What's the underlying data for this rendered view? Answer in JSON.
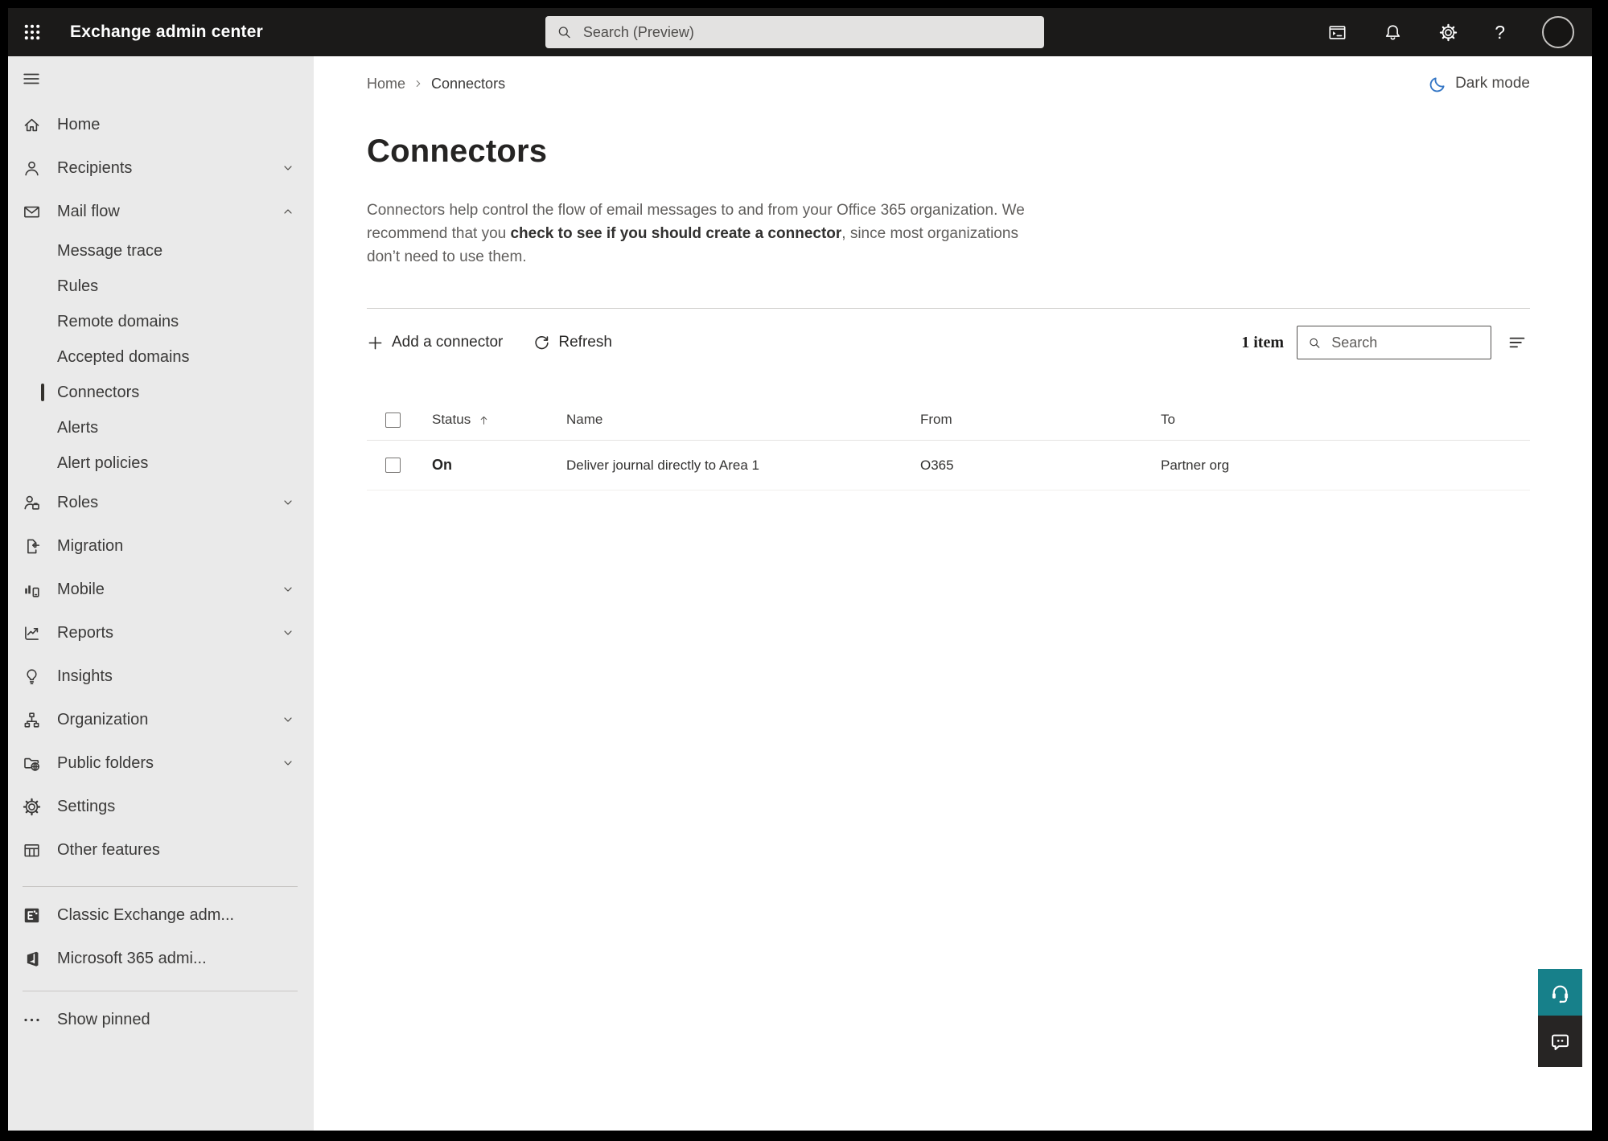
{
  "topbar": {
    "title": "Exchange admin center",
    "search_placeholder": "Search (Preview)"
  },
  "sidebar": {
    "items": [
      {
        "label": "Home"
      },
      {
        "label": "Recipients"
      },
      {
        "label": "Mail flow"
      },
      {
        "label": "Message trace"
      },
      {
        "label": "Rules"
      },
      {
        "label": "Remote domains"
      },
      {
        "label": "Accepted domains"
      },
      {
        "label": "Connectors",
        "selected": true
      },
      {
        "label": "Alerts"
      },
      {
        "label": "Alert policies"
      },
      {
        "label": "Roles"
      },
      {
        "label": "Migration"
      },
      {
        "label": "Mobile"
      },
      {
        "label": "Reports"
      },
      {
        "label": "Insights"
      },
      {
        "label": "Organization"
      },
      {
        "label": "Public folders"
      },
      {
        "label": "Settings"
      },
      {
        "label": "Other features"
      },
      {
        "label": "Classic Exchange adm..."
      },
      {
        "label": "Microsoft 365 admi..."
      },
      {
        "label": "Show pinned"
      }
    ]
  },
  "main": {
    "breadcrumb": {
      "home": "Home",
      "current": "Connectors"
    },
    "dark_mode_label": "Dark mode",
    "page_title": "Connectors",
    "description": {
      "pre": "Connectors help control the flow of email messages to and from your Office 365 organization. We recommend that you ",
      "link": "check to see if you should create a connector",
      "post": ", since most organizations don’t need to use them."
    },
    "toolbar": {
      "add_label": "Add a connector",
      "refresh_label": "Refresh",
      "item_count": "1 item",
      "search_placeholder": "Search"
    },
    "table": {
      "headers": {
        "status": "Status",
        "name": "Name",
        "from": "From",
        "to": "To"
      },
      "rows": [
        {
          "status": "On",
          "name": "Deliver journal directly to Area 1",
          "from": "O365",
          "to": "Partner org"
        }
      ]
    }
  },
  "colors": {
    "topbar_bg": "#1b1a19",
    "sidebar_bg": "#eaeaea",
    "accent_teal": "#17808a",
    "moon_blue": "#3476c5",
    "text_primary": "#252423",
    "text_secondary": "#605e5c"
  },
  "icons": {
    "app_launcher": "waffle-grid",
    "powershell": "terminal-window",
    "notifications": "bell",
    "settings": "gear",
    "help": "?",
    "account": "avatar-circle",
    "menu": "hamburger",
    "home": "house",
    "recipients": "person",
    "mail_flow": "envelope",
    "roles": "person-badge",
    "migration": "document-arrow",
    "mobile": "chart-phone",
    "reports": "trend-line",
    "insights": "lightbulb",
    "organization": "org-chart",
    "public_folders": "folder-globe",
    "other_features": "table-grid",
    "classic_exchange": "exchange-logo",
    "microsoft_365": "office-logo",
    "show_pinned": "ellipsis",
    "dark_mode": "moon",
    "add": "plus",
    "refresh": "circular-arrow",
    "search": "magnifier",
    "sort": "sort-lines",
    "sort_ascending": "arrow-up",
    "support": "headset",
    "feedback": "chat-bubble"
  }
}
